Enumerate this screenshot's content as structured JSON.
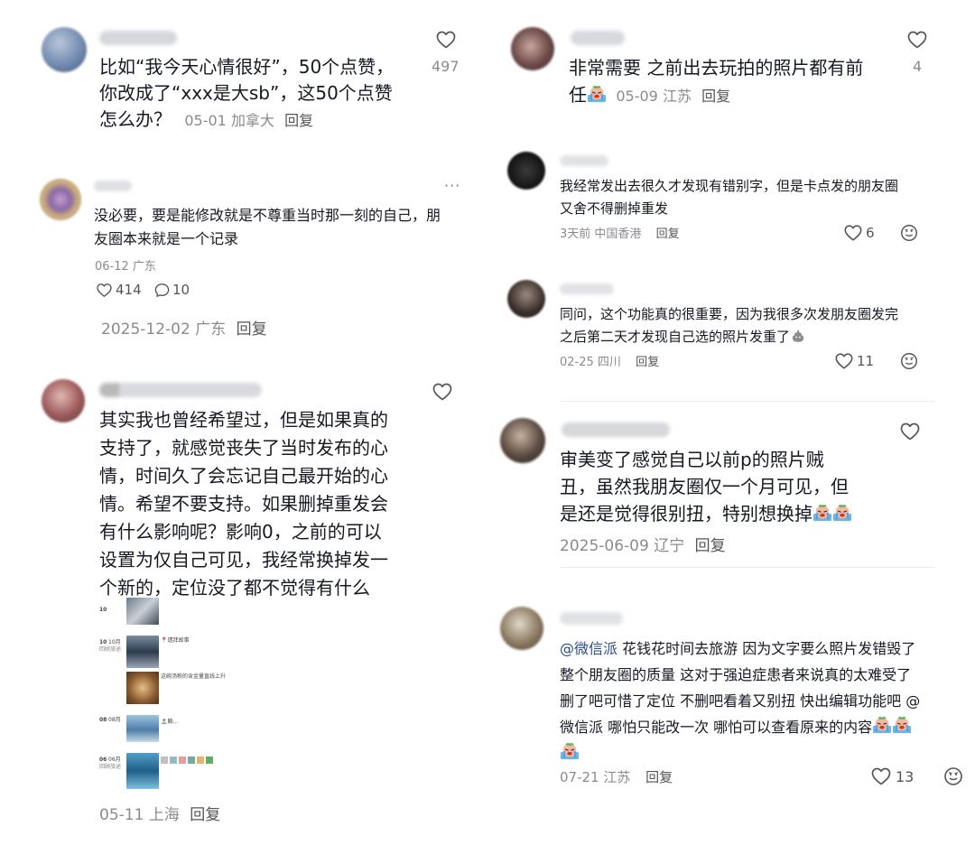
{
  "left": {
    "c1": {
      "text_lines": [
        "比如“我今天心情很好”，50个点赞，",
        "你改成了“xxx是大sb”，这50个点赞",
        "怎么办？"
      ],
      "date": "05-01",
      "location": "加拿大",
      "reply": "回复",
      "likes": "497"
    },
    "c2": {
      "more": "···",
      "text_lines": [
        "没必要，要是能修改就是不尊重当时那一刻的自己，朋",
        "友圈本来就是一个记录"
      ],
      "date": "06-12 广东",
      "likes": "414",
      "comments": "10",
      "footer_date": "2025-12-02",
      "footer_location": "广东",
      "footer_reply": "回复"
    },
    "c3": {
      "text_lines": [
        "其实我也曾经希望过，但是如果真的",
        "支持了，就感觉丧失了当时发布的心",
        "情，时间久了会忘记自己最开始的心",
        "情。希望不要支持。如果删掉重发会",
        "有什么影响呢？影响0，之前的可以",
        "设置为仅自己可见，我经常换掉发一",
        "个新的，定位没了都不觉得有什么"
      ],
      "date": "05-11",
      "location": "上海",
      "reply": "回复",
      "shot": {
        "d1": "10",
        "m1": "10月",
        "d2": "10",
        "m2": "10月",
        "s2": "回顾旅途",
        "p1": "📍遗拜故事",
        "p2": "这碗汤粉的含金量直线上升",
        "d3": "08",
        "m3": "08月",
        "p3": "🏝️躺...",
        "d4": "06",
        "m4": "06月",
        "s4": "回顾旅途"
      }
    }
  },
  "right": {
    "r1": {
      "text_lines": [
        "非常需要 之前出去玩拍的照片都有前",
        "任"
      ],
      "date": "05-09",
      "location": "江苏",
      "reply": "回复",
      "likes": "4"
    },
    "r2": {
      "text_lines": [
        "我经常发出去很久才发现有错别字，但是卡点发的朋友圈",
        "又舍不得删掉重发"
      ],
      "date": "3天前",
      "location": "中国香港",
      "reply": "回复",
      "likes": "6"
    },
    "r3": {
      "text_lines": [
        "同问，这个功能真的很重要，因为我很多次发朋友圈发完",
        "之后第二天才发现自己选的照片发重了"
      ],
      "date": "02-25",
      "location": "四川",
      "reply": "回复",
      "likes": "11"
    },
    "r4": {
      "text_lines": [
        "审美变了感觉自己以前p的照片贼",
        "丑，虽然我朋友圈仅一个月可见，但",
        "是还是觉得很别扭，特别想换掉"
      ],
      "date": "2025-06-09",
      "location": "辽宁",
      "reply": "回复"
    },
    "r5": {
      "mention1": "@微信派",
      "line1_rest": " 花钱花时间去旅游 因为文字要么照片发错毁了",
      "lines": [
        "整个朋友圈的质量 这对于强迫症患者来说真的太难受了",
        "删了吧可惜了定位 不删吧看着又别扭 快出编辑功能吧 @",
        "微信派  哪怕只能改一次 哪怕可以查看原来的内容"
      ],
      "date": "07-21",
      "location": "江苏",
      "reply": "回复",
      "likes": "13"
    }
  },
  "colors": {
    "text": "#161823",
    "meta": "#8a8b91",
    "divider": "#ececec",
    "mention": "#2a4a8a"
  },
  "icons": [
    "heart-icon",
    "comment-icon",
    "smile-icon",
    "more-icon",
    "crying-emoji",
    "poop-emoji"
  ]
}
